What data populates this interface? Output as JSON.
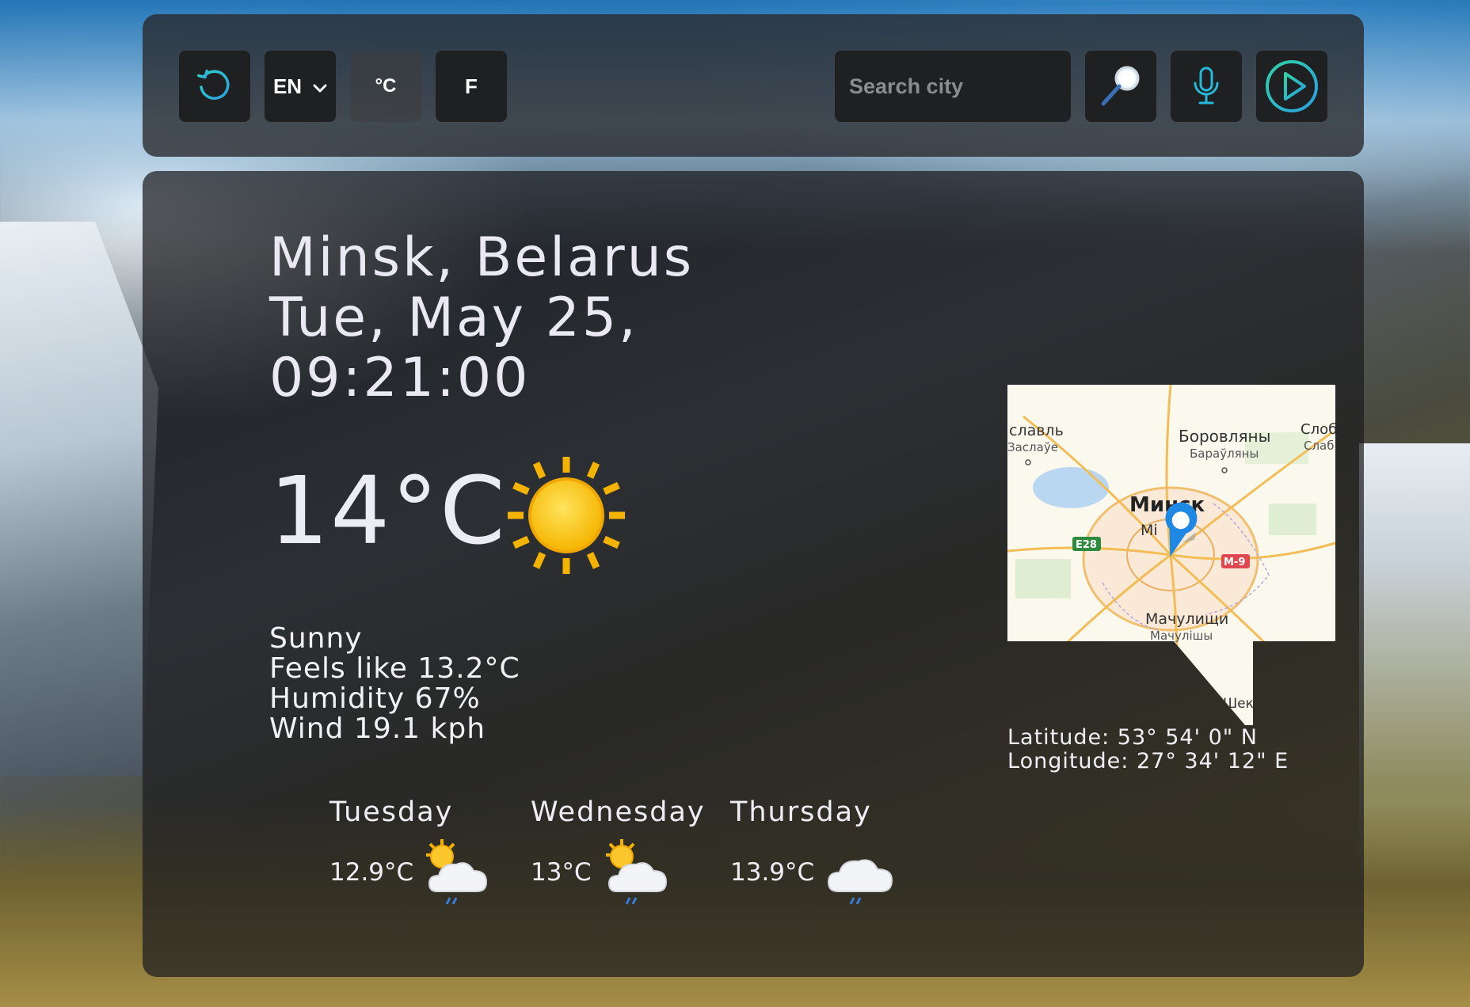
{
  "toolbar": {
    "lang_label": "EN",
    "celsius_label": "°C",
    "fahrenheit_label": "F",
    "search_placeholder": "Search city"
  },
  "current": {
    "city": "Minsk, Belarus",
    "date": "Tue, May 25,",
    "time": "09:21:00",
    "temperature": "14°C",
    "condition_icon": "sun-icon",
    "description": "Sunny",
    "feels_like": "Feels like 13.2°C",
    "humidity": "Humidity 67%",
    "wind": "Wind 19.1 kph"
  },
  "forecast": [
    {
      "day": "Tuesday",
      "temp": "12.9°C",
      "icon": "sun-cloud-rain-icon"
    },
    {
      "day": "Wednesday",
      "temp": "13°C",
      "icon": "sun-cloud-rain-icon"
    },
    {
      "day": "Thursday",
      "temp": "13.9°C",
      "icon": "cloud-rain-icon"
    }
  ],
  "map": {
    "labels": {
      "top_left": "славль",
      "top_left_sub": "Заслаўе",
      "top_mid": "Боровляны",
      "top_mid_sub": "Бараўляны",
      "top_right": "Слоб",
      "top_right_sub": "Слаб",
      "center": "Минск",
      "center_sub": "Мі",
      "bottom": "Мачулищи",
      "bottom_sub": "Мачулішы",
      "bottom_right": "Шеко",
      "road_e28": "E28",
      "road_m9": "M-9"
    },
    "latitude": "Latitude: 53° 54' 0\" N",
    "longitude": "Longitude: 27° 34' 12\" E"
  },
  "colors": {
    "accent": "#21c4d6",
    "sun": "#fbc02d",
    "panel": "#28282a"
  }
}
